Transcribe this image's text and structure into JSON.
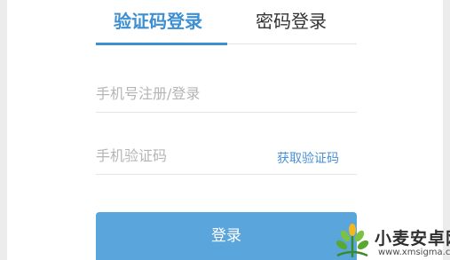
{
  "tabs": {
    "active_label": "验证码登录",
    "inactive_label": "密码登录"
  },
  "form": {
    "phone_placeholder": "手机号注册/登录",
    "code_placeholder": "手机验证码",
    "get_code_label": "获取验证码",
    "login_label": "登录"
  },
  "watermark": {
    "name": "小麦安卓网",
    "url": "www.xmsigma.com"
  },
  "colors": {
    "accent": "#3d8fd1",
    "button": "#5ba5dd",
    "background": "#ececec"
  },
  "icons": {
    "watermark_logo": "wheat-logo-icon"
  }
}
